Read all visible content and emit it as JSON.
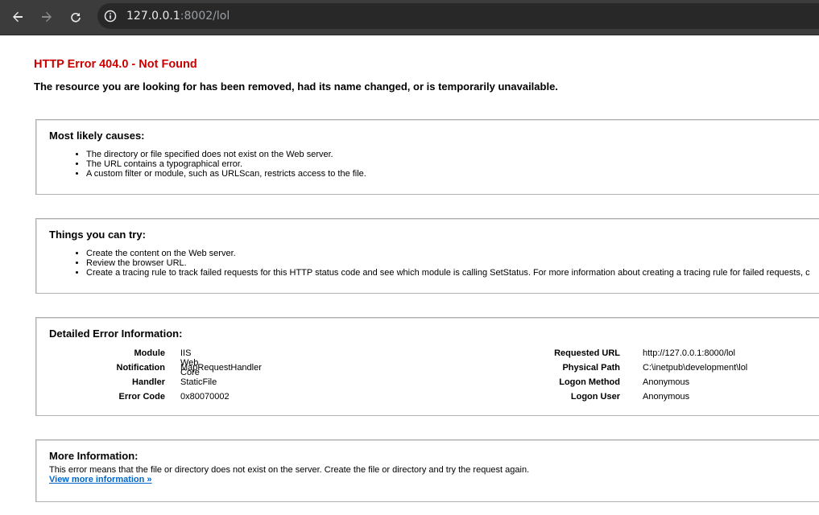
{
  "browser": {
    "url_host": "127.0.0.1",
    "url_path": ":8002/lol",
    "icons": [
      "back-icon",
      "forward-icon",
      "reload-icon",
      "site-info-icon"
    ]
  },
  "page": {
    "title": "HTTP Error 404.0 - Not Found",
    "subtitle": "The resource you are looking for has been removed, had its name changed, or is temporarily unavailable.",
    "causes": {
      "heading": "Most likely causes:",
      "items": [
        "The directory or file specified does not exist on the Web server.",
        "The URL contains a typographical error.",
        "A custom filter or module, such as URLScan, restricts access to the file."
      ]
    },
    "try": {
      "heading": "Things you can try:",
      "items": [
        "Create the content on the Web server.",
        "Review the browser URL.",
        "Create a tracing rule to track failed requests for this HTTP status code and see which module is calling SetStatus. For more information about creating a tracing rule for failed requests, c"
      ]
    },
    "details": {
      "heading": "Detailed Error Information:",
      "left": [
        {
          "key": "Module",
          "value": "IIS Web Core"
        },
        {
          "key": "Notification",
          "value": "MapRequestHandler"
        },
        {
          "key": "Handler",
          "value": "StaticFile"
        },
        {
          "key": "Error Code",
          "value": "0x80070002"
        }
      ],
      "right": [
        {
          "key": "Requested URL",
          "value": "http://127.0.0.1:8000/lol"
        },
        {
          "key": "Physical Path",
          "value": "C:\\inetpub\\development\\lol"
        },
        {
          "key": "Logon Method",
          "value": "Anonymous"
        },
        {
          "key": "Logon User",
          "value": "Anonymous"
        }
      ]
    },
    "more": {
      "heading": "More Information:",
      "text": "This error means that the file or directory does not exist on the server. Create the file or directory and try the request again.",
      "link": "View more information »"
    }
  },
  "colors": {
    "toolbar": "#3c3c3c",
    "error_title": "#cc0000",
    "link": "#0066cc"
  }
}
